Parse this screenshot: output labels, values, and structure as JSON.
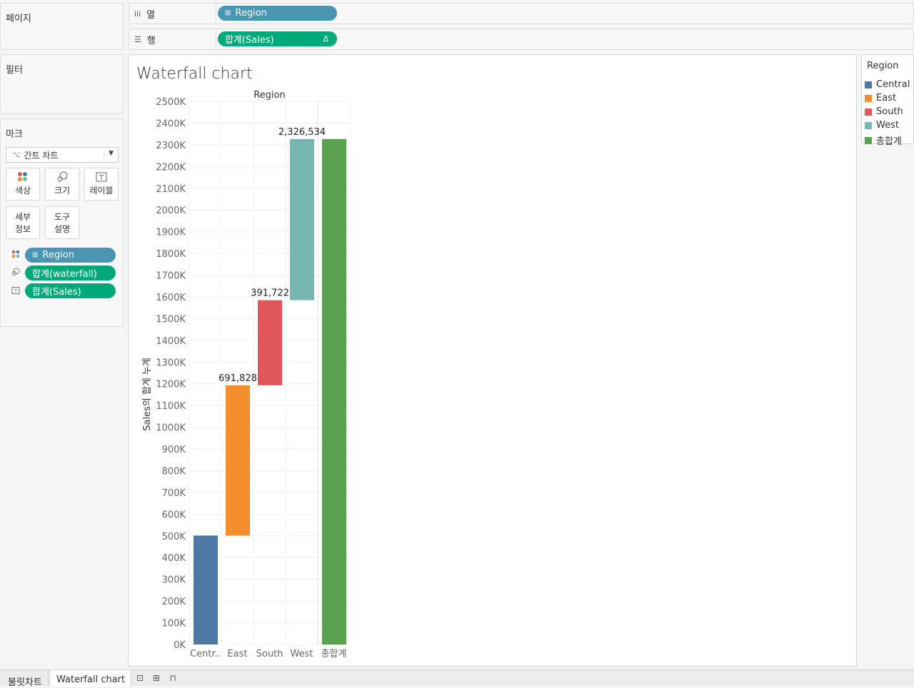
{
  "left_panel": {
    "pages_title": "페이지",
    "filters_title": "필터",
    "marks_title": "마크",
    "mark_type": "간트 차트",
    "mark_type_icon": "gantt-icon",
    "buttons": [
      {
        "label": "색상",
        "icon": "color-dots-icon"
      },
      {
        "label": "크기",
        "icon": "size-icon"
      },
      {
        "label": "레이블",
        "icon": "label-icon"
      },
      {
        "label_line1": "세부",
        "label_line2": "정보",
        "icon": ""
      },
      {
        "label_line1": "도구",
        "label_line2": "설명",
        "icon": ""
      }
    ],
    "mark_pills": [
      {
        "label": "Region",
        "icon": "color-dots-icon",
        "prefix": "⊞"
      },
      {
        "label": "합계(waterfall)",
        "icon": "size-icon"
      },
      {
        "label": "합계(Sales)",
        "icon": "label-icon"
      }
    ]
  },
  "shelves": {
    "columns": {
      "label": "열",
      "pill": "Region",
      "pill_prefix": "⊞"
    },
    "rows": {
      "label": "행",
      "pill": "합계(Sales)",
      "pill_suffix": "Δ"
    }
  },
  "chart": {
    "title": "Waterfall chart",
    "header": "Region",
    "ylabel": "Sales의 합계 누계",
    "x_ticklabels": [
      "Centr..",
      "East",
      "South",
      "West",
      "총합계"
    ]
  },
  "chart_data": {
    "type": "bar",
    "subtype": "waterfall",
    "title": "Waterfall chart",
    "xlabel": "Region",
    "ylabel": "Sales의 합계 누계",
    "categories": [
      "Central",
      "East",
      "South",
      "West",
      "총합계"
    ],
    "bar_start": [
      0,
      501240,
      1193068,
      1584790,
      0
    ],
    "bar_end": [
      501240,
      1193068,
      1584790,
      2326534,
      2326534
    ],
    "values": [
      501240,
      691828,
      391722,
      741744,
      2326534
    ],
    "data_labels": [
      "",
      "691,828",
      "391,722",
      "2,326,534",
      ""
    ],
    "colors": [
      "#4e79a7",
      "#f28e2b",
      "#e15759",
      "#76b7b2",
      "#59a14f"
    ],
    "ylim": [
      0,
      2500000
    ],
    "yticks": [
      0,
      100000,
      200000,
      300000,
      400000,
      500000,
      600000,
      700000,
      800000,
      900000,
      1000000,
      1100000,
      1200000,
      1300000,
      1400000,
      1500000,
      1600000,
      1700000,
      1800000,
      1900000,
      2000000,
      2100000,
      2200000,
      2300000,
      2400000,
      2500000
    ],
    "ytick_labels": [
      "0K",
      "100K",
      "200K",
      "300K",
      "400K",
      "500K",
      "600K",
      "700K",
      "800K",
      "900K",
      "1000K",
      "1100K",
      "1200K",
      "1300K",
      "1400K",
      "1500K",
      "1600K",
      "1700K",
      "1800K",
      "1900K",
      "2000K",
      "2100K",
      "2200K",
      "2300K",
      "2400K",
      "2500K"
    ],
    "grid": true
  },
  "legend": {
    "title": "Region",
    "items": [
      {
        "label": "Central",
        "color": "#4e79a7"
      },
      {
        "label": "East",
        "color": "#f28e2b"
      },
      {
        "label": "South",
        "color": "#e15759"
      },
      {
        "label": "West",
        "color": "#76b7b2"
      },
      {
        "label": "총합계",
        "color": "#59a14f"
      }
    ]
  },
  "tabs": {
    "items": [
      "불릿차트",
      "Waterfall chart"
    ],
    "active": "Waterfall chart",
    "icons": [
      "new-sheet-icon",
      "new-dashboard-icon",
      "new-story-icon"
    ]
  }
}
